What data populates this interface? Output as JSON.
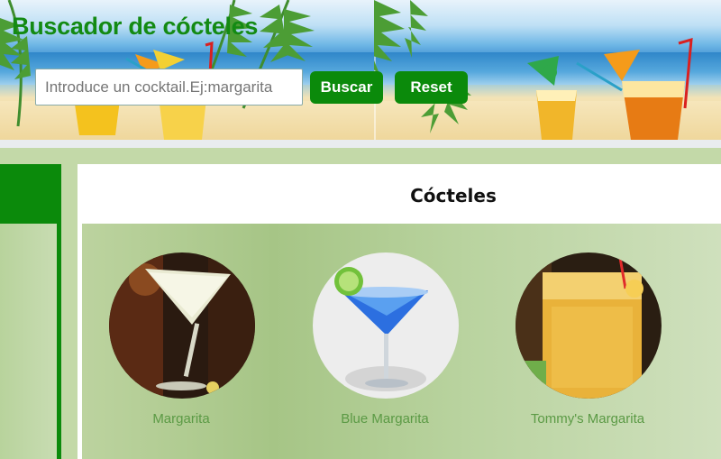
{
  "header": {
    "title": "Buscador de cócteles",
    "search_placeholder": "Introduce un cocktail.Ej:margarita",
    "search_value": "",
    "search_button": "Buscar",
    "reset_button": "Reset"
  },
  "main": {
    "title": "Cócteles",
    "cocktails": [
      {
        "name": "Margarita"
      },
      {
        "name": "Blue Margarita"
      },
      {
        "name": "Tommy's Margarita"
      }
    ]
  },
  "colors": {
    "brand_green": "#0b8a0b",
    "title_green": "#138a13",
    "card_label": "#5b9a45",
    "panel_bg": "#bcd39f"
  },
  "icons": {
    "header": "beach-banner",
    "thumbs": [
      "margarita-photo",
      "blue-margarita-photo",
      "tommys-margarita-photo"
    ]
  }
}
